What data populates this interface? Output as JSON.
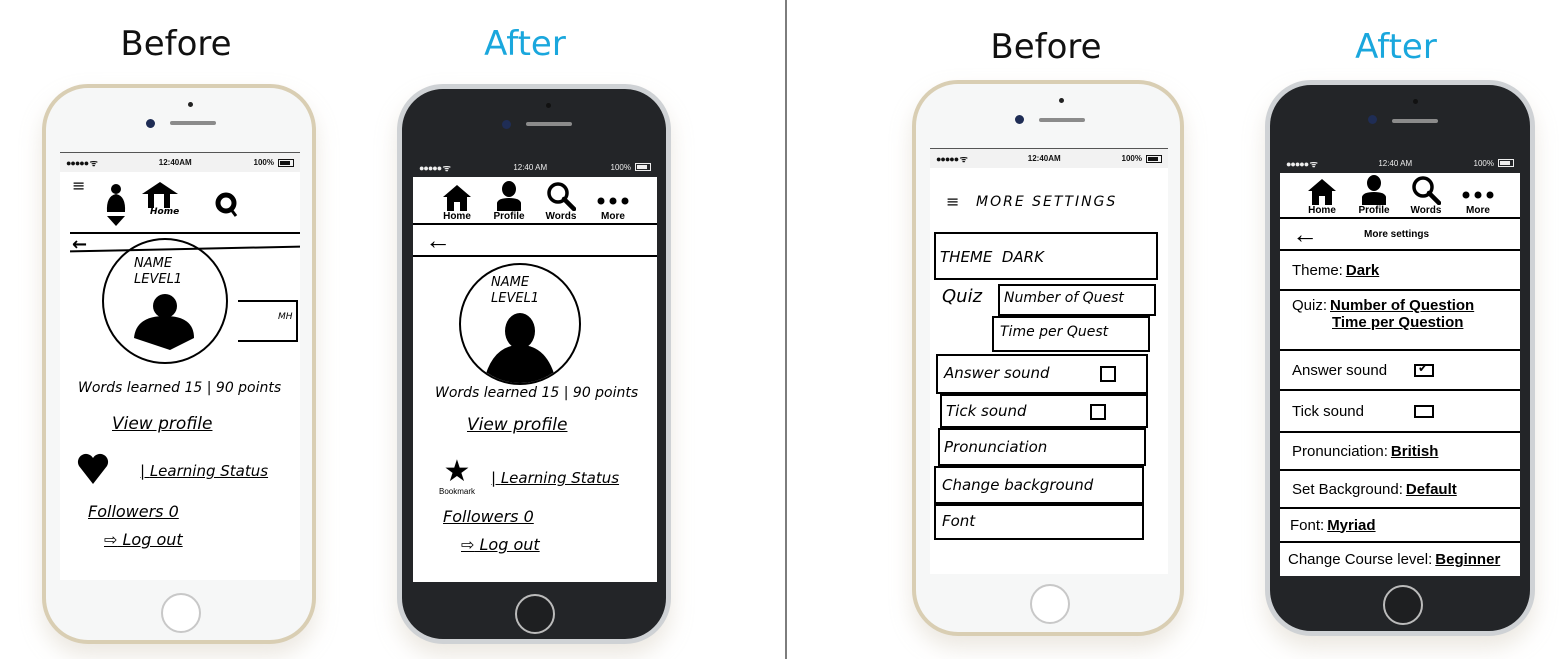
{
  "panels": [
    {
      "label": "Before",
      "variant": "before"
    },
    {
      "label": "After",
      "variant": "after"
    },
    {
      "label": "Before",
      "variant": "before"
    },
    {
      "label": "After",
      "variant": "after"
    }
  ],
  "status_bar": {
    "before_time": "12:40AM",
    "after_time": "12:40 AM",
    "battery": "100%",
    "signal": "●●●●●"
  },
  "profile_before": {
    "nav_icons": [
      "menu-icon",
      "profile-icon",
      "home-icon",
      "search-icon"
    ],
    "home_label": "Home",
    "name": "NAME",
    "level": "LEVEL1",
    "side_tab": "MH",
    "words_learned": "Words learned 15",
    "points": "90 points",
    "view_profile": "View profile",
    "learning_status": "Learning Status",
    "followers": "Followers 0",
    "logout": "Log out"
  },
  "profile_after": {
    "nav": [
      {
        "label": "Home",
        "icon": "home-icon"
      },
      {
        "label": "Profile",
        "icon": "profile-icon"
      },
      {
        "label": "Words",
        "icon": "search-icon"
      },
      {
        "label": "More",
        "icon": "more-icon"
      }
    ],
    "back": "←",
    "name": "NAME",
    "level": "LEVEL1",
    "words_learned": "Words learned 15",
    "points": "90 points",
    "view_profile": "View profile",
    "bookmark": "Bookmark",
    "learning_status": "Learning Status",
    "followers": "Followers 0",
    "logout": "Log out"
  },
  "settings_before": {
    "title": "MORE SETTINGS",
    "theme": "THEME  DARK",
    "quiz": "Quiz",
    "quiz_number": "Number of Quest",
    "quiz_time": "Time per Quest",
    "answer_sound": "Answer sound",
    "tick_sound": "Tick sound",
    "pronunciation": "Pronunciation",
    "change_background": "Change background",
    "font": "Font"
  },
  "settings_after": {
    "nav": [
      {
        "label": "Home",
        "icon": "home-icon"
      },
      {
        "label": "Profile",
        "icon": "profile-icon"
      },
      {
        "label": "Words",
        "icon": "search-icon"
      },
      {
        "label": "More",
        "icon": "more-icon"
      }
    ],
    "back": "←",
    "title": "More settings",
    "theme_label": "Theme:",
    "theme_value": "Dark",
    "quiz_label": "Quiz:",
    "quiz_number": "Number of Question",
    "quiz_time": "Time per Question",
    "answer_sound_label": "Answer sound",
    "answer_sound_checked": true,
    "tick_sound_label": "Tick sound",
    "tick_sound_checked": false,
    "pronunciation_label": "Pronunciation:",
    "pronunciation_value": "British",
    "background_label": "Set Background:",
    "background_value": "Default",
    "font_label": "Font:",
    "font_value": "Myriad",
    "course_label": "Change Course level:",
    "course_value": "Beginner"
  }
}
